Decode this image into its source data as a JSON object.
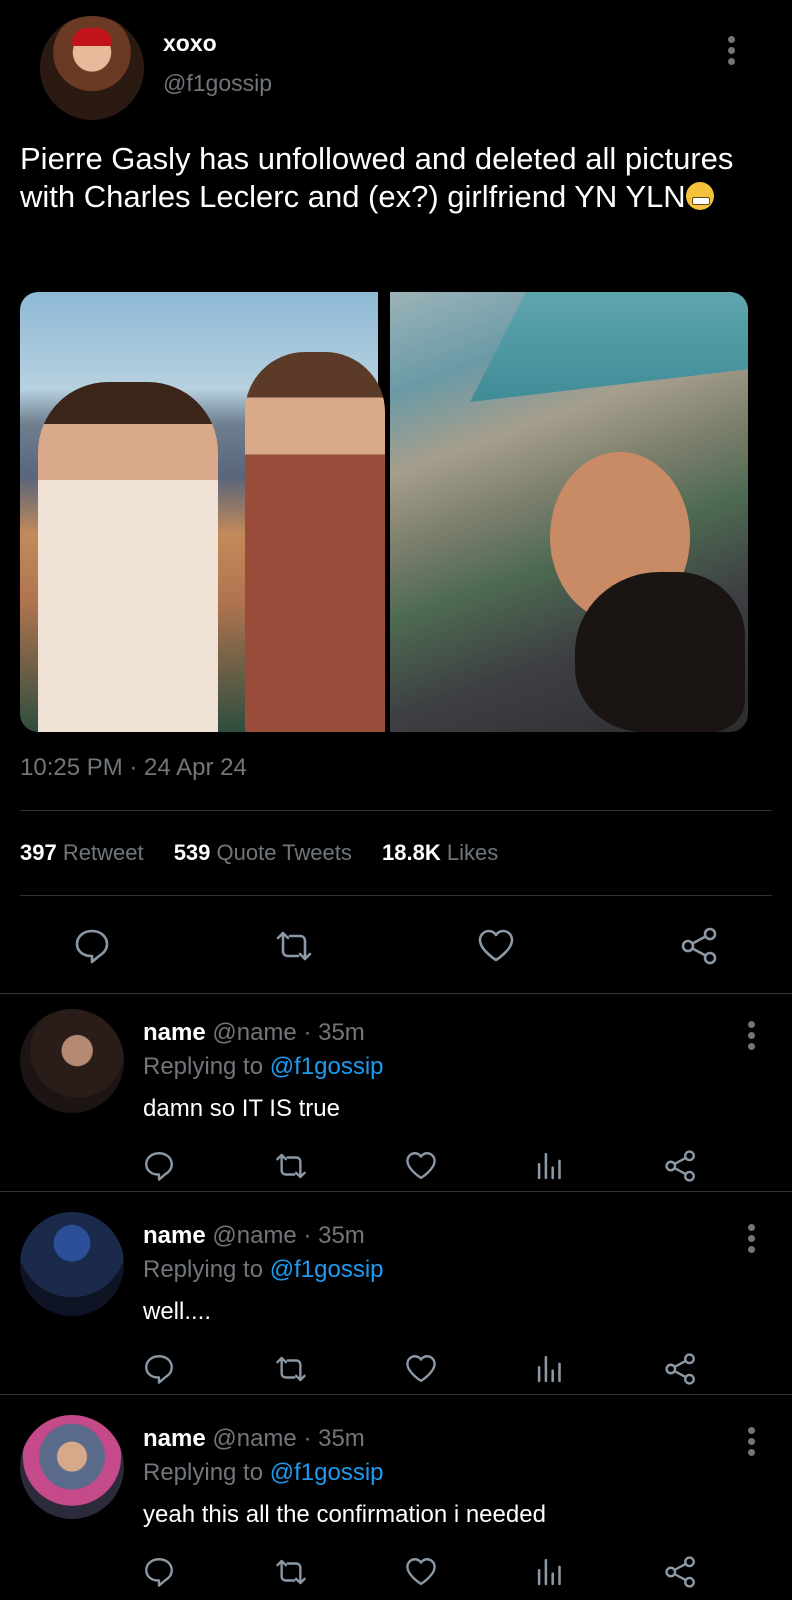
{
  "tweet": {
    "display_name": "xoxo",
    "handle": "@f1gossip",
    "text": "Pierre Gasly has unfollowed and deleted all pictures with Charles Leclerc and (ex?) girlfriend YN YLN",
    "emoji": "grimacing-face",
    "timestamp": "10:25 PM · 24 Apr 24",
    "stats": [
      {
        "count": "397",
        "label": "Retweet"
      },
      {
        "count": "539",
        "label": "Quote Tweets"
      },
      {
        "count": "18.8K",
        "label": "Likes"
      }
    ]
  },
  "replies": [
    {
      "name": "name",
      "handle_time": "@name · 35m",
      "replying_prefix": "Replying to",
      "replying_to": "@f1gossip",
      "text": "damn so IT IS true"
    },
    {
      "name": "name",
      "handle_time": "@name · 35m",
      "replying_prefix": "Replying to",
      "replying_to": "@f1gossip",
      "text": "well...."
    },
    {
      "name": "name",
      "handle_time": "@name · 35m",
      "replying_prefix": "Replying to",
      "replying_to": "@f1gossip",
      "text": "yeah this all the confirmation i needed"
    }
  ],
  "icons": {
    "reply": "reply-icon",
    "retweet": "retweet-icon",
    "like": "heart-icon",
    "views": "views-icon",
    "share": "share-icon",
    "more": "more-icon"
  },
  "colors": {
    "background": "#000000",
    "text": "#e7e9ea",
    "muted": "#71767b",
    "link": "#1d9bf0",
    "divider": "#2f3336"
  }
}
